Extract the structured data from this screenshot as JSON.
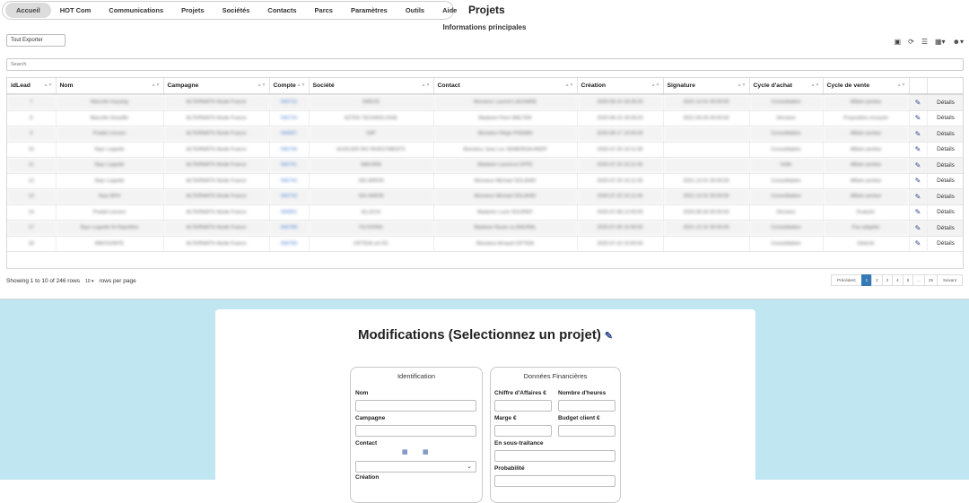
{
  "nav": {
    "items": [
      "Accueil",
      "HOT Com",
      "Communications",
      "Projets",
      "Sociétés",
      "Contacts",
      "Parcs",
      "Paramètres",
      "Outils",
      "Aide"
    ]
  },
  "page": {
    "title": "Projets",
    "section_title": "Informations principales"
  },
  "toolbar": {
    "export_label": "Tout Exporter",
    "search_placeholder": "Search",
    "icons": [
      "toggle-icon",
      "refresh-icon",
      "list-icon",
      "columns-icon",
      "user-icon"
    ]
  },
  "table": {
    "columns": [
      "idLead",
      "Nom",
      "Campagne",
      "Compte",
      "Société",
      "Contact",
      "Création",
      "Signature",
      "Cycle d'achat",
      "Cycle de vente",
      "",
      ""
    ],
    "rows": [
      [
        "7",
        "Marcelin Kaysing",
        "ALTERNATIV Ainde France",
        "NW723",
        "GREVE",
        "Monsieur Laurent LACHARE",
        "2020-08-15 18:28:20",
        "2021-12-01 00:00:00",
        "Consolidation",
        "Affaire perdue"
      ],
      [
        "8",
        "Marcelin Deauffin",
        "ALTERNATIV Ainde France",
        "NW724",
        "AZTEK TECHNOLOGIE",
        "Madame Flore WALTER",
        "2020-08-15 18:28:20",
        "2021-09-30 00:00:00",
        "Décision",
        "Proposition envoyée"
      ],
      [
        "9",
        "Pradal Lionsen",
        "ALTERNATIV Ainde France",
        "NW897",
        "SIIP",
        "Monsieur Régis PIGNAN",
        "2020-08-17 10:00:00",
        "",
        "Consolidation",
        "Affaire perdue"
      ],
      [
        "10",
        "Nayr Logarite",
        "ALTERNATIV Ainde France",
        "NW740",
        "AUXILIER INV INVESTMENTS",
        "Monsieur Jean Luc SEMERGIA ANDP",
        "2020-07-20 10:11:00",
        "",
        "Consolidation",
        "Affaire perdue"
      ],
      [
        "11",
        "Nayr Logarite",
        "ALTERNATIV Ainde France",
        "NW741",
        "NAVORA",
        "Madame Laurence EFFE",
        "2020-07-20 10:11:00",
        "",
        "Veille",
        "Affaire perdue"
      ],
      [
        "12",
        "Nayr Logarite",
        "ALTERNATIV Ainde France",
        "NW742",
        "SIG AIRON",
        "Monsieur Michael SOLAHID",
        "2020-07-20 10:11:00",
        "2021-12-01 00:00:00",
        "Consolidation",
        "Affaire perdue"
      ],
      [
        "13",
        "Nayr BFH",
        "ALTERNATIV Ainde France",
        "NW743",
        "SIG AIRON",
        "Monsieur Michael SOLAHID",
        "2020-07-20 10:11:00",
        "2021-12-01 00:00:00",
        "Consolidation",
        "Affaire perdue"
      ],
      [
        "14",
        "Pradal Lionsen",
        "ALTERNATIV Ainde France",
        "NW891",
        "ALLECH",
        "Madame Lucie SOURIEF",
        "2020-07-08 12:00:00",
        "2020-08-30 00:00:00",
        "Décision",
        "Évaluée"
      ],
      [
        "17",
        "Nayr Logarite IH Rapréline",
        "ALTERNATIV Ainde France",
        "NW788",
        "FILIVIONS",
        "Madame Nuran ou BAURAL",
        "2020-07-09 15:00:00",
        "2021-12-31 00:00:00",
        "Consolidation",
        "Pas adaptée"
      ],
      [
        "18",
        "MAVOUNITE",
        "ALTERNATIV Ainde France",
        "NW789",
        "CIFTEIA cel OC",
        "Monsieur Arnaud CIFTEIA",
        "2020-07-10 10:00:00",
        "",
        "Consolidation",
        "Détecté"
      ]
    ],
    "details_label": "Détails"
  },
  "footer": {
    "showing": "Showing 1 to 10 of 246 rows",
    "page_size": "10",
    "rows_per_page": "rows per page",
    "pages": [
      "Précédent",
      "1",
      "2",
      "3",
      "4",
      "5",
      "...",
      "25",
      "Suivant"
    ],
    "active_page": "1"
  },
  "form": {
    "title": "Modifications (Selectionnez un projet)",
    "identification": {
      "title": "Identification",
      "nom": "Nom",
      "campagne": "Campagne",
      "contact": "Contact",
      "creation": "Création"
    },
    "financier": {
      "title": "Données Financières",
      "ca": "Chiffre d'Affaires €",
      "heures": "Nombre d'heures",
      "marge": "Marge €",
      "budget": "Budget client €",
      "sous_traitance": "En sous-traitance",
      "probabilite": "Probabilité"
    }
  },
  "colors": {
    "accent": "#337ab7",
    "lower_bg": "#bfe6f1",
    "edit_icon": "#2e4a8a"
  }
}
